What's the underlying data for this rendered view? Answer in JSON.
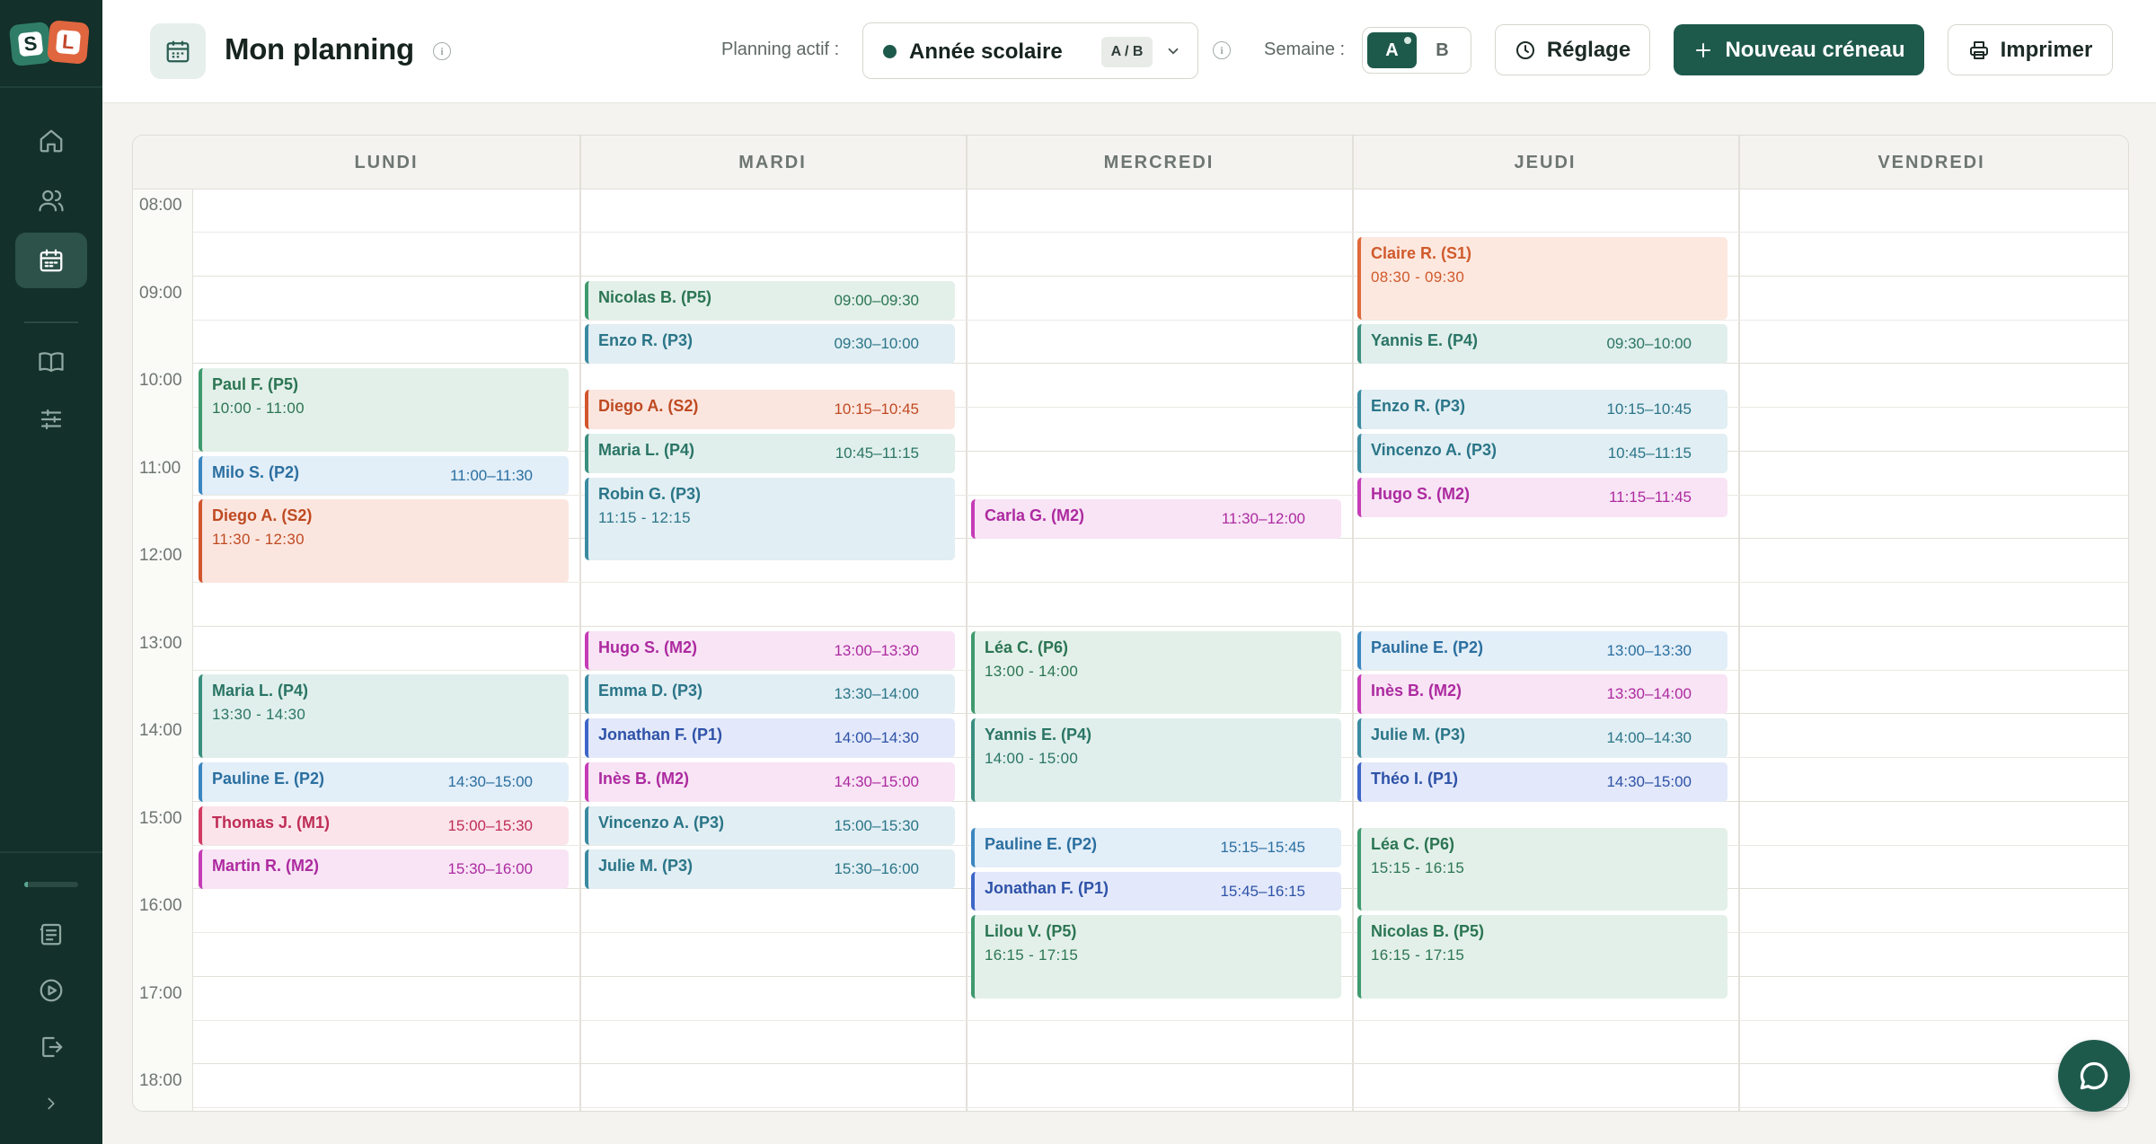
{
  "app": {
    "logo_letters": [
      "S",
      "L"
    ]
  },
  "sidebar": {
    "nav": [
      "home-icon",
      "users-icon",
      "calendar-icon",
      "book-icon",
      "sliders-icon"
    ],
    "bottom": [
      "report-icon",
      "play-icon",
      "logout-icon",
      "chevron-right-icon"
    ],
    "progress": 0.06
  },
  "header": {
    "title": "Mon planning",
    "planning_label": "Planning actif :",
    "planning_value": "Année scolaire",
    "planning_badge": "A / B",
    "week_label": "Semaine :",
    "week_options": [
      "A",
      "B"
    ],
    "week_selected": "A",
    "settings_label": "Réglage",
    "new_slot_label": "Nouveau créneau",
    "print_label": "Imprimer"
  },
  "calendar": {
    "days": [
      "LUNDI",
      "MARDI",
      "MERCREDI",
      "JEUDI",
      "VENDREDI"
    ],
    "hours": [
      "08:00",
      "09:00",
      "10:00",
      "11:00",
      "12:00",
      "13:00",
      "14:00",
      "15:00",
      "16:00",
      "17:00",
      "18:00"
    ],
    "events": [
      {
        "day": 0,
        "start": 10.0,
        "end": 11.0,
        "name": "Paul F. (P5)",
        "time": "10:00 - 11:00",
        "color": "green"
      },
      {
        "day": 0,
        "start": 11.0,
        "end": 11.5,
        "name": "Milo S. (P2)",
        "time": "11:00–11:30",
        "color": "blue"
      },
      {
        "day": 0,
        "start": 11.5,
        "end": 12.5,
        "name": "Diego A. (S2)",
        "time": "11:30 - 12:30",
        "color": "orange"
      },
      {
        "day": 0,
        "start": 13.5,
        "end": 14.5,
        "name": "Maria L. (P4)",
        "time": "13:30 - 14:30",
        "color": "teal"
      },
      {
        "day": 0,
        "start": 14.5,
        "end": 15.0,
        "name": "Pauline E. (P2)",
        "time": "14:30–15:00",
        "color": "blue"
      },
      {
        "day": 0,
        "start": 15.0,
        "end": 15.5,
        "name": "Thomas J. (M1)",
        "time": "15:00–15:30",
        "color": "red"
      },
      {
        "day": 0,
        "start": 15.5,
        "end": 16.0,
        "name": "Martin R. (M2)",
        "time": "15:30–16:00",
        "color": "magenta"
      },
      {
        "day": 1,
        "start": 9.0,
        "end": 9.5,
        "name": "Nicolas B. (P5)",
        "time": "09:00–09:30",
        "color": "green"
      },
      {
        "day": 1,
        "start": 9.5,
        "end": 10.0,
        "name": "Enzo R. (P3)",
        "time": "09:30–10:00",
        "color": "teal2"
      },
      {
        "day": 1,
        "start": 10.25,
        "end": 10.75,
        "name": "Diego A. (S2)",
        "time": "10:15–10:45",
        "color": "orange"
      },
      {
        "day": 1,
        "start": 10.75,
        "end": 11.25,
        "name": "Maria L. (P4)",
        "time": "10:45–11:15",
        "color": "teal"
      },
      {
        "day": 1,
        "start": 11.25,
        "end": 12.25,
        "name": "Robin G. (P3)",
        "time": "11:15 - 12:15",
        "color": "teal2"
      },
      {
        "day": 1,
        "start": 13.0,
        "end": 13.5,
        "name": "Hugo S. (M2)",
        "time": "13:00–13:30",
        "color": "magenta"
      },
      {
        "day": 1,
        "start": 13.5,
        "end": 14.0,
        "name": "Emma D. (P3)",
        "time": "13:30–14:00",
        "color": "teal2"
      },
      {
        "day": 1,
        "start": 14.0,
        "end": 14.5,
        "name": "Jonathan F. (P1)",
        "time": "14:00–14:30",
        "color": "indigo"
      },
      {
        "day": 1,
        "start": 14.5,
        "end": 15.0,
        "name": "Inès B. (M2)",
        "time": "14:30–15:00",
        "color": "magenta"
      },
      {
        "day": 1,
        "start": 15.0,
        "end": 15.5,
        "name": "Vincenzo A. (P3)",
        "time": "15:00–15:30",
        "color": "teal2"
      },
      {
        "day": 1,
        "start": 15.5,
        "end": 16.0,
        "name": "Julie M. (P3)",
        "time": "15:30–16:00",
        "color": "teal2"
      },
      {
        "day": 2,
        "start": 11.5,
        "end": 12.0,
        "name": "Carla G. (M2)",
        "time": "11:30–12:00",
        "color": "magenta"
      },
      {
        "day": 2,
        "start": 13.0,
        "end": 14.0,
        "name": "Léa C. (P6)",
        "time": "13:00 - 14:00",
        "color": "green"
      },
      {
        "day": 2,
        "start": 14.0,
        "end": 15.0,
        "name": "Yannis E. (P4)",
        "time": "14:00 - 15:00",
        "color": "teal"
      },
      {
        "day": 2,
        "start": 15.25,
        "end": 15.75,
        "name": "Pauline E. (P2)",
        "time": "15:15–15:45",
        "color": "blue"
      },
      {
        "day": 2,
        "start": 15.75,
        "end": 16.25,
        "name": "Jonathan F. (P1)",
        "time": "15:45–16:15",
        "color": "indigo"
      },
      {
        "day": 2,
        "start": 16.25,
        "end": 17.25,
        "name": "Lilou V. (P5)",
        "time": "16:15 - 17:15",
        "color": "green"
      },
      {
        "day": 3,
        "start": 8.5,
        "end": 9.5,
        "name": "Claire R. (S1)",
        "time": "08:30 - 09:30",
        "color": "orange2"
      },
      {
        "day": 3,
        "start": 9.5,
        "end": 10.0,
        "name": "Yannis E. (P4)",
        "time": "09:30–10:00",
        "color": "teal"
      },
      {
        "day": 3,
        "start": 10.25,
        "end": 10.75,
        "name": "Enzo R. (P3)",
        "time": "10:15–10:45",
        "color": "teal2"
      },
      {
        "day": 3,
        "start": 10.75,
        "end": 11.25,
        "name": "Vincenzo A. (P3)",
        "time": "10:45–11:15",
        "color": "teal2"
      },
      {
        "day": 3,
        "start": 11.25,
        "end": 11.75,
        "name": "Hugo S. (M2)",
        "time": "11:15–11:45",
        "color": "magenta"
      },
      {
        "day": 3,
        "start": 13.0,
        "end": 13.5,
        "name": "Pauline E. (P2)",
        "time": "13:00–13:30",
        "color": "blue"
      },
      {
        "day": 3,
        "start": 13.5,
        "end": 14.0,
        "name": "Inès B. (M2)",
        "time": "13:30–14:00",
        "color": "magenta"
      },
      {
        "day": 3,
        "start": 14.0,
        "end": 14.5,
        "name": "Julie M. (P3)",
        "time": "14:00–14:30",
        "color": "teal2"
      },
      {
        "day": 3,
        "start": 14.5,
        "end": 15.0,
        "name": "Théo I. (P1)",
        "time": "14:30–15:00",
        "color": "indigo"
      },
      {
        "day": 3,
        "start": 15.25,
        "end": 16.25,
        "name": "Léa C. (P6)",
        "time": "15:15 - 16:15",
        "color": "green"
      },
      {
        "day": 3,
        "start": 16.25,
        "end": 17.25,
        "name": "Nicolas B. (P5)",
        "time": "16:15 - 17:15",
        "color": "green"
      }
    ]
  },
  "colors": {
    "brand": "#1e5a4c",
    "sidebar_bg": "#13302a",
    "palette": {
      "green": {
        "bg": "#e3f0e9",
        "border": "#3f9a6e",
        "text": "#2b7553"
      },
      "teal": {
        "bg": "#e0efeb",
        "border": "#3a8f7e",
        "text": "#2a7566"
      },
      "teal2": {
        "bg": "#e1eef3",
        "border": "#3a8aa0",
        "text": "#2a7588"
      },
      "blue": {
        "bg": "#e2eef8",
        "border": "#3a86c0",
        "text": "#2b6fa0"
      },
      "indigo": {
        "bg": "#e3e9fa",
        "border": "#3e66c8",
        "text": "#2e52a8"
      },
      "orange": {
        "bg": "#fbe6df",
        "border": "#d2562e",
        "text": "#bf4a22"
      },
      "orange2": {
        "bg": "#fde8df",
        "border": "#e0683a",
        "text": "#d05a2c"
      },
      "red": {
        "bg": "#fbe4ea",
        "border": "#d23c64",
        "text": "#bf2d56"
      },
      "magenta": {
        "bg": "#f8e4f5",
        "border": "#c53cb6",
        "text": "#ad2aa0"
      }
    }
  },
  "chat": {
    "icon": "chat-icon"
  }
}
